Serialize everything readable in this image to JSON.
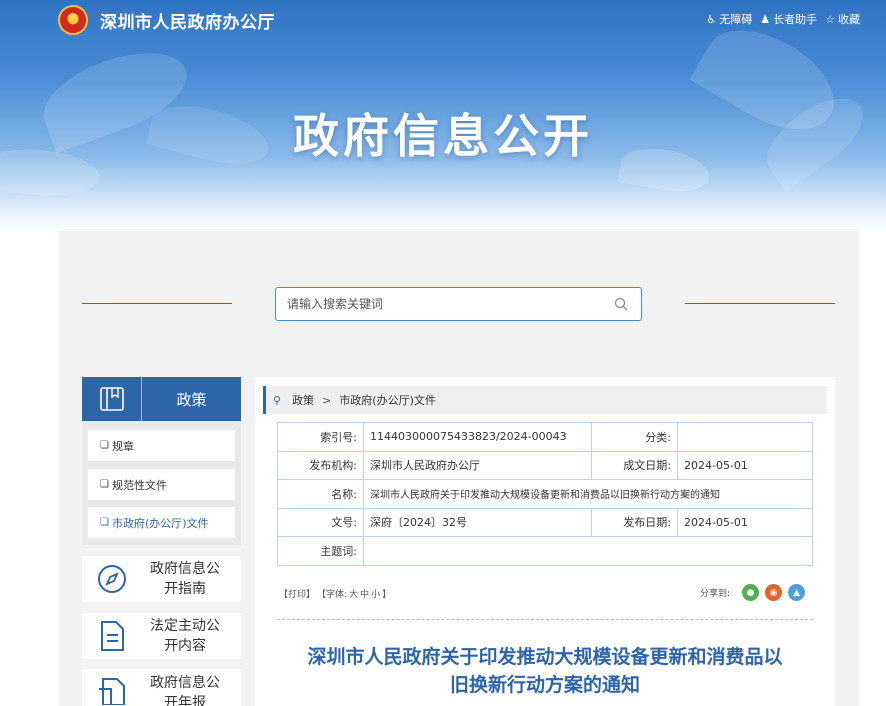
{
  "header": {
    "site_title": "深圳市人民政府办公厅",
    "banner_title": "政府信息公开",
    "links": [
      {
        "icon": "accessibility-icon",
        "label": "无障碍"
      },
      {
        "icon": "elder-helper-icon",
        "label": "长者助手"
      },
      {
        "icon": "star-icon",
        "label": "收藏"
      }
    ]
  },
  "search": {
    "placeholder": "请输入搜索关键词"
  },
  "sidebar": {
    "heading": "政策",
    "items": [
      {
        "label": "规章"
      },
      {
        "label": "规范性文件"
      },
      {
        "label": "市政府(办公厅)文件",
        "active": true
      }
    ],
    "cards": [
      {
        "icon": "compass-icon",
        "label": "政府信息公开指南"
      },
      {
        "icon": "document-icon",
        "label": "法定主动公开内容"
      },
      {
        "icon": "report-icon",
        "label": "政府信息公开年报"
      }
    ]
  },
  "breadcrumb": [
    "政策",
    "市政府(办公厅)文件"
  ],
  "meta": {
    "index_label": "索引号:",
    "index_value": "11440300007543382 3/2024-00043",
    "category_label": "分类:",
    "category_value": "",
    "publisher_label": "发布机构:",
    "publisher_value": "深圳市人民政府办公厅",
    "created_label": "成文日期:",
    "created_value": "2024-05-01",
    "name_label": "名称:",
    "name_value": "深圳市人民政府关于印发推动大规模设备更新和消费品以旧换新行动方案的通知",
    "docno_label": "文号:",
    "docno_value": "深府〔2024〕32号",
    "published_label": "发布日期:",
    "published_value": "2024-05-01",
    "subject_label": "主题词:",
    "subject_value": ""
  },
  "tools": {
    "print": "【打印】",
    "font_prefix": "【字体:",
    "font_large": "大",
    "font_medium": "中",
    "font_small": "小",
    "font_suffix": "】"
  },
  "share": {
    "label": "分享到:"
  },
  "doc": {
    "title_line1": "深圳市人民政府关于印发推动大规模设备更新和消费品以",
    "title_line2": "旧换新行动方案的通知"
  },
  "colors": {
    "brand_blue": "#2d65a8",
    "share_wechat": "#4cb04e",
    "share_weibo": "#e4632b",
    "share_qq": "#4aa2da"
  }
}
